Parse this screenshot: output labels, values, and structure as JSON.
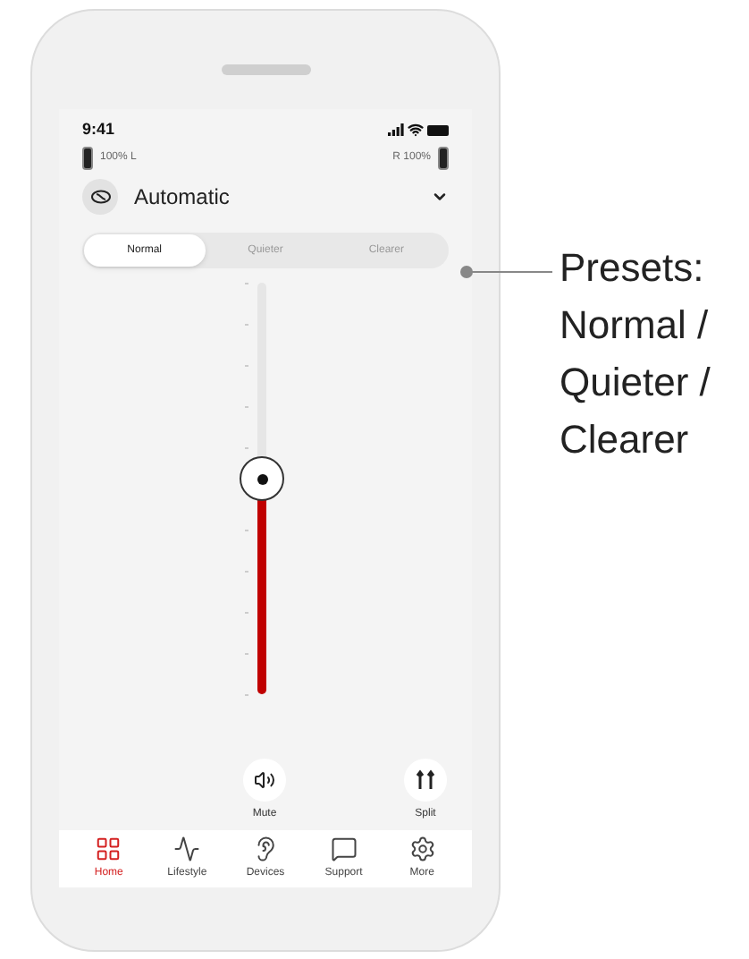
{
  "status_bar": {
    "time": "9:41"
  },
  "batteries": {
    "left": "100% L",
    "right": "R 100%"
  },
  "program": {
    "name": "Automatic"
  },
  "presets": [
    {
      "label": "Normal",
      "selected": true
    },
    {
      "label": "Quieter",
      "selected": false
    },
    {
      "label": "Clearer",
      "selected": false
    }
  ],
  "volume": {
    "level": 0.52
  },
  "actions": [
    {
      "kind": "mute",
      "label": "Mute"
    },
    {
      "kind": "split",
      "label": "Split"
    }
  ],
  "nav": [
    {
      "kind": "home",
      "label": "Home",
      "selected": true
    },
    {
      "kind": "lifestyle",
      "label": "Lifestyle",
      "selected": false
    },
    {
      "kind": "devices",
      "label": "Devices",
      "selected": false
    },
    {
      "kind": "support",
      "label": "Support",
      "selected": false
    },
    {
      "kind": "more",
      "label": "More",
      "selected": false
    }
  ],
  "annotation": "Presets: Normal / Quieter / Clearer"
}
